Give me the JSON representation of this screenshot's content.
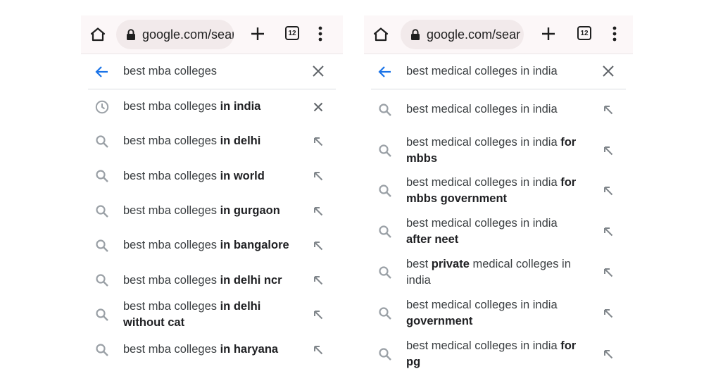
{
  "panels": [
    {
      "toolbar": {
        "url": "google.com/sear",
        "tab_count": "12"
      },
      "query": "best mba colleges",
      "suggestions": [
        {
          "type": "history",
          "trail": "remove",
          "parts": [
            {
              "t": "best mba colleges ",
              "b": false
            },
            {
              "t": "in india",
              "b": true
            }
          ]
        },
        {
          "type": "search",
          "trail": "fill",
          "parts": [
            {
              "t": "best mba colleges ",
              "b": false
            },
            {
              "t": "in delhi",
              "b": true
            }
          ]
        },
        {
          "type": "search",
          "trail": "fill",
          "parts": [
            {
              "t": "best mba colleges ",
              "b": false
            },
            {
              "t": "in world",
              "b": true
            }
          ]
        },
        {
          "type": "search",
          "trail": "fill",
          "parts": [
            {
              "t": "best mba colleges ",
              "b": false
            },
            {
              "t": "in gurgaon",
              "b": true
            }
          ]
        },
        {
          "type": "search",
          "trail": "fill",
          "parts": [
            {
              "t": "best mba colleges ",
              "b": false
            },
            {
              "t": "in bangalore",
              "b": true
            }
          ]
        },
        {
          "type": "search",
          "trail": "fill",
          "parts": [
            {
              "t": "best mba colleges ",
              "b": false
            },
            {
              "t": "in delhi ncr",
              "b": true
            }
          ]
        },
        {
          "type": "search",
          "trail": "fill",
          "parts": [
            {
              "t": "best mba colleges ",
              "b": false
            },
            {
              "t": "in delhi without cat",
              "b": true
            }
          ]
        },
        {
          "type": "search",
          "trail": "fill",
          "parts": [
            {
              "t": "best mba colleges ",
              "b": false
            },
            {
              "t": "in haryana",
              "b": true
            }
          ]
        }
      ]
    },
    {
      "toolbar": {
        "url": "google.com/sear",
        "tab_count": "12"
      },
      "query": "best medical colleges in india",
      "suggestions": [
        {
          "type": "search",
          "trail": "fill",
          "parts": [
            {
              "t": "best medical colleges in india",
              "b": false
            }
          ]
        },
        {
          "type": "search",
          "trail": "fill",
          "parts": [
            {
              "t": "best medical colleges in india ",
              "b": false
            },
            {
              "t": "for mbbs",
              "b": true
            }
          ]
        },
        {
          "type": "search",
          "trail": "fill",
          "parts": [
            {
              "t": "best medical colleges in india ",
              "b": false
            },
            {
              "t": "for mbbs government",
              "b": true
            }
          ]
        },
        {
          "type": "search",
          "trail": "fill",
          "parts": [
            {
              "t": "best medical colleges in india ",
              "b": false
            },
            {
              "t": "after neet",
              "b": true
            }
          ]
        },
        {
          "type": "search",
          "trail": "fill",
          "parts": [
            {
              "t": "best ",
              "b": false
            },
            {
              "t": "private",
              "b": true
            },
            {
              "t": " medical colleges in india",
              "b": false
            }
          ]
        },
        {
          "type": "search",
          "trail": "fill",
          "parts": [
            {
              "t": "best medical colleges in india ",
              "b": false
            },
            {
              "t": "government",
              "b": true
            }
          ]
        },
        {
          "type": "search",
          "trail": "fill",
          "parts": [
            {
              "t": "best medical colleges in india ",
              "b": false
            },
            {
              "t": "for pg",
              "b": true
            }
          ]
        }
      ]
    }
  ],
  "icons": {
    "home": "home-icon",
    "lock": "lock-icon",
    "new_tab": "plus-icon",
    "tabs": "tab-switcher-icon",
    "menu": "more-vert-icon",
    "back": "arrow-back-icon",
    "clear": "close-icon",
    "history": "history-clock-icon",
    "search": "search-icon",
    "fill": "arrow-up-left-icon"
  },
  "colors": {
    "accent": "#1a73e8",
    "toolbar_bg": "#fcf7f8",
    "pill_bg": "#f2eaeb",
    "icon_gray": "#9aa0a6"
  }
}
